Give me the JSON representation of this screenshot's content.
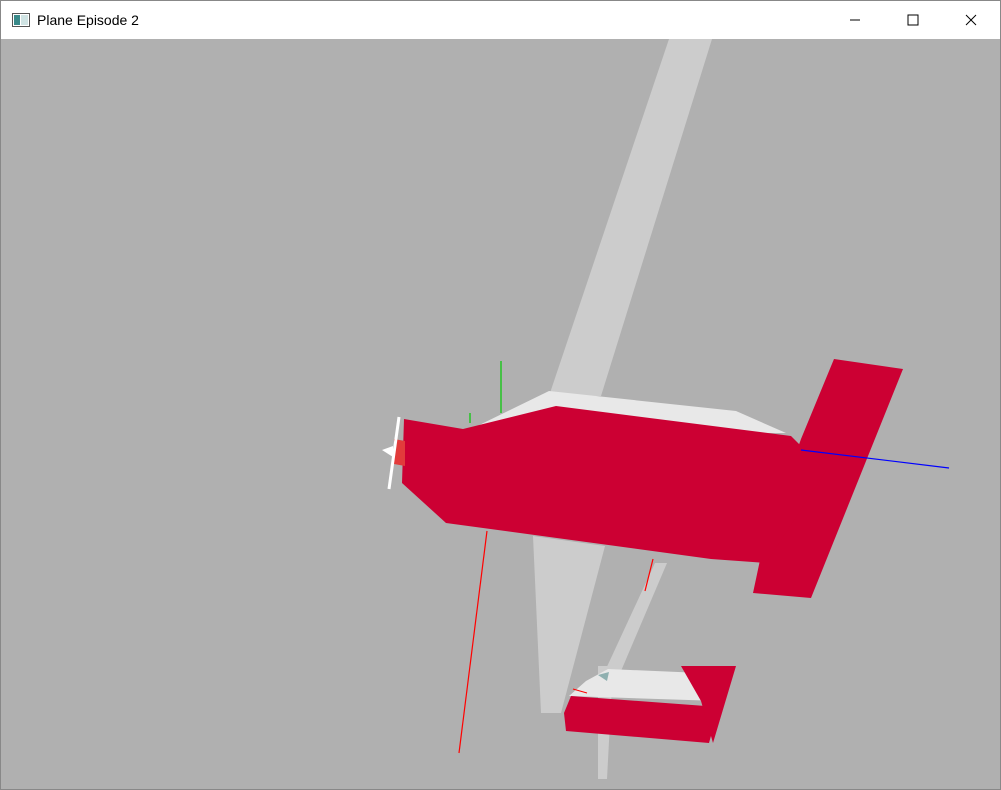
{
  "window": {
    "title": "Plane Episode 2",
    "controls": [
      {
        "name": "minimize-button",
        "icon": "minimize-icon"
      },
      {
        "name": "maximize-button",
        "icon": "maximize-icon"
      },
      {
        "name": "close-button",
        "icon": "close-icon"
      }
    ]
  },
  "scene": {
    "background_color": "#b0b0b0",
    "plane_color": "#cc0033",
    "wing_color": "#cccccc",
    "canopy_color": "#e8e8e8",
    "axis_colors": {
      "x": "#ff0000",
      "y": "#00cc00",
      "z": "#0000ff"
    }
  }
}
